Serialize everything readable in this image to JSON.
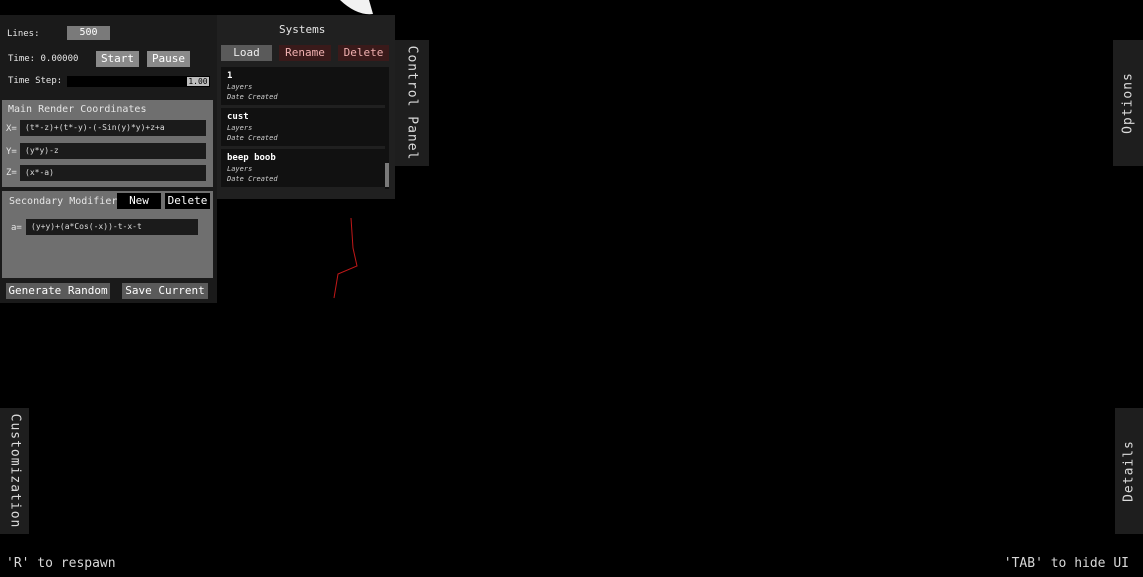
{
  "control_panel": {
    "lines_label": "Lines:",
    "lines_value": "500",
    "time_label": "Time: 0.00000",
    "start_label": "Start",
    "pause_label": "Pause",
    "timestep_label": "Time Step:",
    "timestep_value": "1.00",
    "main_render": {
      "title": "Main Render Coordinates",
      "x_label": "X=",
      "x_value": "(t*-z)+(t*-y)-(-Sin(y)*y)+z+a",
      "y_label": "Y=",
      "y_value": "(y*y)-z",
      "z_label": "Z=",
      "z_value": "(x*-a)"
    },
    "secondary": {
      "title": "Secondary Modifiers",
      "new_label": "New",
      "delete_label": "Delete",
      "a_label": "a=",
      "a_value": "(y+y)+(a*Cos(-x))-t-x-t"
    },
    "generate_random_label": "Generate Random",
    "save_current_label": "Save Current"
  },
  "systems": {
    "title": "Systems",
    "load_label": "Load",
    "rename_label": "Rename",
    "delete_label": "Delete",
    "items": [
      {
        "name": "1",
        "layers": "Layers",
        "date": "Date Created"
      },
      {
        "name": "cust",
        "layers": "Layers",
        "date": "Date Created"
      },
      {
        "name": "beep boob",
        "layers": "Layers",
        "date": "Date Created"
      }
    ]
  },
  "tabs": {
    "control_panel": "Control Panel",
    "options": "Options",
    "customization": "Customization",
    "details": "Details"
  },
  "hints": {
    "respawn": "'R' to respawn",
    "hide_ui": "'TAB' to hide UI"
  },
  "colors": {
    "red_button_bg": "#3a1a1a",
    "red_button_text": "#f0b0b0",
    "trace_line": "#cc2020"
  }
}
